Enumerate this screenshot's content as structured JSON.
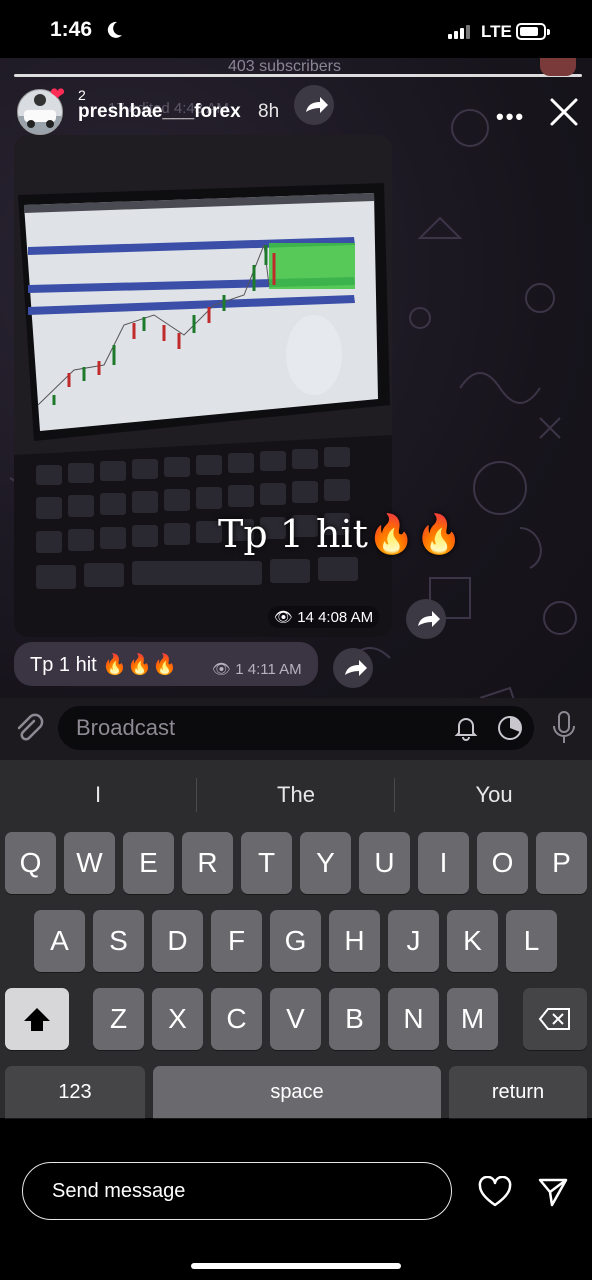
{
  "status_bar": {
    "time": "1:46",
    "network": "LTE"
  },
  "story": {
    "subscribers_text": "403 subscribers",
    "like_count": "2",
    "username": "preshbae___forex",
    "time_ago": "8h",
    "edited_ghost": "17 edited 4:43 AM"
  },
  "messages": {
    "photo_overlay_text": "Tp 1 hit🔥🔥",
    "photo_views": "14",
    "photo_time": "4:08 AM",
    "text_message": "Tp 1 hit 🔥🔥🔥",
    "text_views": "1",
    "text_time": "4:11 AM"
  },
  "composer": {
    "placeholder": "Broadcast"
  },
  "keyboard": {
    "suggestions": [
      "I",
      "The",
      "You"
    ],
    "row1": [
      "Q",
      "W",
      "E",
      "R",
      "T",
      "Y",
      "U",
      "I",
      "O",
      "P"
    ],
    "row2": [
      "A",
      "S",
      "D",
      "F",
      "G",
      "H",
      "J",
      "K",
      "L"
    ],
    "row3": [
      "Z",
      "X",
      "C",
      "V",
      "B",
      "N",
      "M"
    ],
    "numbers_key": "123",
    "space_key": "space",
    "return_key": "return"
  },
  "bottom_bar": {
    "placeholder": "Send message"
  },
  "colors": {
    "heart_badge": "#ff2d55",
    "chart_green": "#3ec43e",
    "chart_blue": "#3b4fa8"
  }
}
